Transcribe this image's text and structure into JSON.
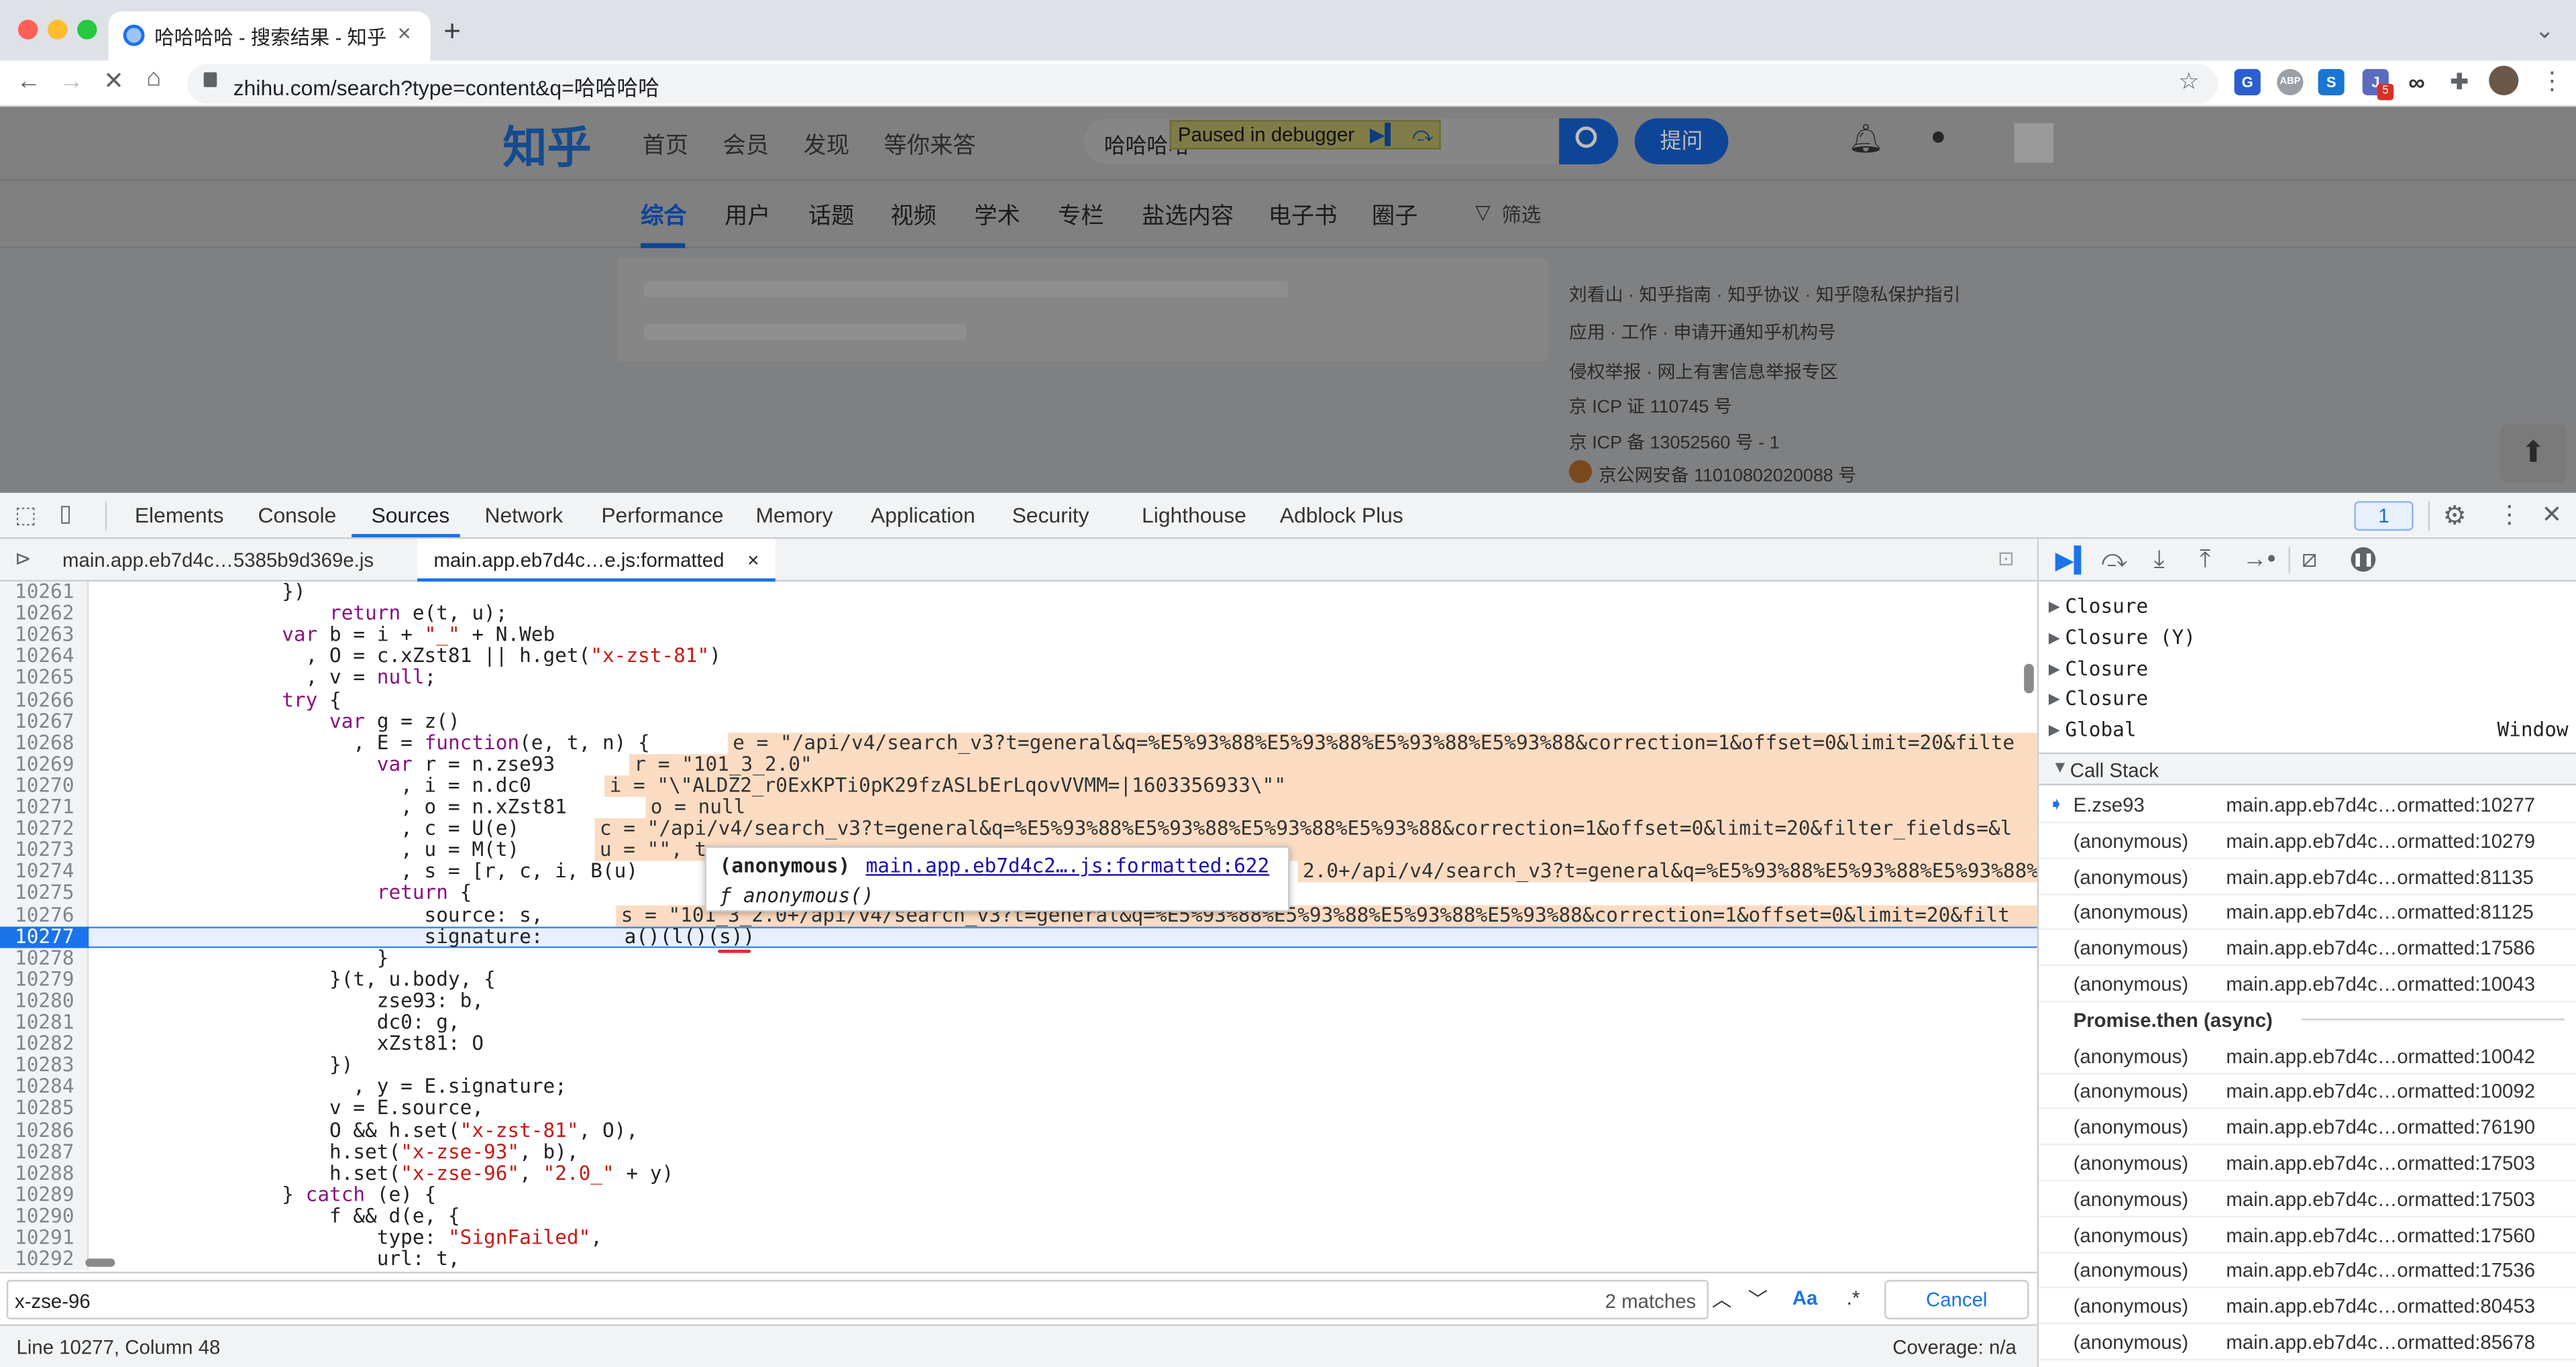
{
  "browser": {
    "tab_title": "哈哈哈哈 - 搜索结果 - 知乎",
    "tab_close": "×",
    "new_tab": "+",
    "url": "zhihu.com/search?type=content&q=哈哈哈哈",
    "ext_badge": "5",
    "ext_abp": "ABP"
  },
  "zhihu": {
    "logo": "知乎",
    "nav": [
      "首页",
      "会员",
      "发现",
      "等你来答"
    ],
    "search_value": "哈哈哈哈",
    "ask_button": "提问",
    "sub_tabs": [
      "综合",
      "用户",
      "话题",
      "视频",
      "学术",
      "专栏",
      "盐选内容",
      "电子书",
      "圈子"
    ],
    "filter_label": "筛选",
    "sidebar_links": [
      "刘看山 · 知乎指南 · 知乎协议 · 知乎隐私保护指引",
      "应用 · 工作 · 申请开通知乎机构号",
      "侵权举报 · 网上有害信息举报专区",
      "京 ICP 证 110745 号",
      "京 ICP 备 13052560 号 - 1",
      "京公网安备 11010802020088 号"
    ]
  },
  "debugger_overlay": {
    "label": "Paused in debugger"
  },
  "devtools": {
    "tabs": [
      "Elements",
      "Console",
      "Sources",
      "Network",
      "Performance",
      "Memory",
      "Application",
      "Security",
      "Lighthouse",
      "Adblock Plus"
    ],
    "selected_tab": "Sources",
    "issues_count": "1",
    "editor_tabs": [
      "main.app.eb7d4c…5385b9d369e.js",
      "main.app.eb7d4c…e.js:formatted"
    ],
    "editor_tab_close": "×",
    "code_lines": [
      {
        "n": "10261",
        "t": "                })"
      },
      {
        "n": "10262",
        "t": "                    return e(t, u);"
      },
      {
        "n": "10263",
        "t": "                var b = i + \"_\" + N.Web"
      },
      {
        "n": "10264",
        "t": "                  , O = c.xZst81 || h.get(\"x-zst-81\")"
      },
      {
        "n": "10265",
        "t": "                  , v = null;"
      },
      {
        "n": "10266",
        "t": "                try {"
      },
      {
        "n": "10267",
        "t": "                    var g = z()"
      },
      {
        "n": "10268",
        "t": "                      , E = function(e, t, n) {"
      },
      {
        "n": "10269",
        "t": "                        var r = n.zse93"
      },
      {
        "n": "10270",
        "t": "                          , i = n.dc0"
      },
      {
        "n": "10271",
        "t": "                          , o = n.xZst81"
      },
      {
        "n": "10272",
        "t": "                          , c = U(e)"
      },
      {
        "n": "10273",
        "t": "                          , u = M(t)"
      },
      {
        "n": "10274",
        "t": "                          , s = [r, c, i, B(u)"
      },
      {
        "n": "10275",
        "t": "                        return {"
      },
      {
        "n": "10276",
        "t": "                            source: s,"
      },
      {
        "n": "10277",
        "t": "                            signature: "
      },
      {
        "n": "10278",
        "t": "                        }"
      },
      {
        "n": "10279",
        "t": "                    }(t, u.body, {"
      },
      {
        "n": "10280",
        "t": "                        zse93: b,"
      },
      {
        "n": "10281",
        "t": "                        dc0: g,"
      },
      {
        "n": "10282",
        "t": "                        xZst81: O"
      },
      {
        "n": "10283",
        "t": "                    })"
      },
      {
        "n": "10284",
        "t": "                      , y = E.signature;"
      },
      {
        "n": "10285",
        "t": "                    v = E.source,"
      },
      {
        "n": "10286",
        "t": "                    O && h.set(\"x-zst-81\", O),"
      },
      {
        "n": "10287",
        "t": "                    h.set(\"x-zse-93\", b),"
      },
      {
        "n": "10288",
        "t": "                    h.set(\"x-zse-96\", \"2.0_\" + y)"
      },
      {
        "n": "10289",
        "t": "                } catch (e) {"
      },
      {
        "n": "10290",
        "t": "                    f && d(e, {"
      },
      {
        "n": "10291",
        "t": "                        type: \"SignFailed\","
      },
      {
        "n": "10292",
        "t": "                        url: t,"
      }
    ],
    "inline_values": [
      {
        "line": "10268",
        "text": "e = \"/api/v4/search_v3?t=general&q=%E5%93%88%E5%93%88%E5%93%88%E5%93%88&correction=1&offset=0&limit=20&filte"
      },
      {
        "line": "10269",
        "text": "r = \"101_3_2.0\""
      },
      {
        "line": "10270",
        "text": "i = \"\\\"ALDZ2_r0ExKPTi0pK29fzASLbErLqovVVMM=|1603356933\\\"\""
      },
      {
        "line": "10271",
        "text": "o = null"
      },
      {
        "line": "10272",
        "text": "c = \"/api/v4/search_v3?t=general&q=%E5%93%88%E5%93%88%E5%93%88%E5%93%88&correction=1&offset=0&limit=20&filter_fields=&l"
      },
      {
        "line": "10273",
        "text": "u = \"\", t"
      },
      {
        "line": "10274",
        "text": "2.0+/api/v4/search_v3?t=general&q=%E5%93%88%E5%93%88%E5%93%88%E5%93%88"
      },
      {
        "line": "10276",
        "text": "s = \"101_3_2.0+/api/v4/search_v3?t=general&q=%E5%93%88%E5%93%88%E5%93%88%E5%93%88&correction=1&offset=0&limit=20&filt"
      }
    ],
    "current_line_calls": "a()(l()(s))",
    "tooltip": {
      "name": "(anonymous)",
      "link": "main.app.eb7d4c2….js:formatted:622",
      "sig": "ƒ anonymous()"
    },
    "search": {
      "query": "x-zse-96",
      "matches": "2 matches",
      "case_label": "Aa",
      "regex_label": ".*",
      "cancel": "Cancel"
    },
    "status": {
      "position": "Line 10277, Column 48",
      "coverage": "Coverage: n/a"
    },
    "scope_items": [
      {
        "label": "Closure",
        "value": ""
      },
      {
        "label": "Closure (Y)",
        "value": ""
      },
      {
        "label": "Closure",
        "value": ""
      },
      {
        "label": "Closure",
        "value": ""
      },
      {
        "label": "Global",
        "value": "Window"
      }
    ],
    "call_stack_title": "Call Stack",
    "call_stack": [
      {
        "fn": "E.zse93",
        "loc": "main.app.eb7d4c…ormatted:10277",
        "current": true
      },
      {
        "fn": "(anonymous)",
        "loc": "main.app.eb7d4c…ormatted:10279"
      },
      {
        "fn": "(anonymous)",
        "loc": "main.app.eb7d4c…ormatted:81135"
      },
      {
        "fn": "(anonymous)",
        "loc": "main.app.eb7d4c…ormatted:81125"
      },
      {
        "fn": "(anonymous)",
        "loc": "main.app.eb7d4c…ormatted:17586"
      },
      {
        "fn": "(anonymous)",
        "loc": "main.app.eb7d4c…ormatted:10043"
      }
    ],
    "async_label": "Promise.then (async)",
    "call_stack_async": [
      {
        "fn": "(anonymous)",
        "loc": "main.app.eb7d4c…ormatted:10042"
      },
      {
        "fn": "(anonymous)",
        "loc": "main.app.eb7d4c…ormatted:10092"
      },
      {
        "fn": "(anonymous)",
        "loc": "main.app.eb7d4c…ormatted:76190"
      },
      {
        "fn": "(anonymous)",
        "loc": "main.app.eb7d4c…ormatted:17503"
      },
      {
        "fn": "(anonymous)",
        "loc": "main.app.eb7d4c…ormatted:17503"
      },
      {
        "fn": "(anonymous)",
        "loc": "main.app.eb7d4c…ormatted:17560"
      },
      {
        "fn": "(anonymous)",
        "loc": "main.app.eb7d4c…ormatted:17536"
      },
      {
        "fn": "(anonymous)",
        "loc": "main.app.eb7d4c…ormatted:80453"
      },
      {
        "fn": "(anonymous)",
        "loc": "main.app.eb7d4c…ormatted:85678"
      }
    ]
  }
}
